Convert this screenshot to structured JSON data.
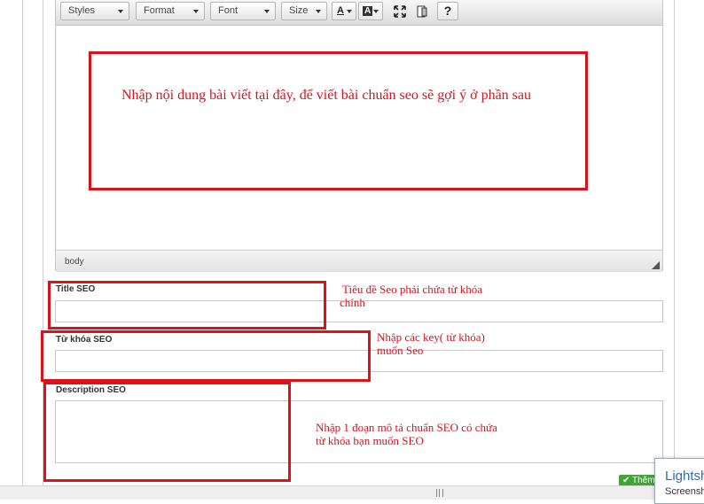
{
  "toolbar": {
    "styles_label": "Styles",
    "format_label": "Format",
    "font_label": "Font",
    "size_label": "Size",
    "text_color_glyph": "A",
    "bg_color_glyph": "A",
    "help_glyph": "?"
  },
  "editor": {
    "placeholder_text": "Nhập nội dung bài viết tại đây, để viết bài chuẩn seo sẽ gợi ý ở phần sau",
    "status_path": "body"
  },
  "fields": {
    "title_label": "Title SEO",
    "keyword_label": "Từ khóa SEO",
    "description_label": "Description SEO"
  },
  "notes": {
    "title_note": "Tiêu đề Seo phải chứa từ khóa chính",
    "keyword_note": "Nhập các key( từ khóa) muốn Seo",
    "description_note": "Nhập 1 đoạn mô tả chuẩn SEO có chứa từ khóa bạn muốn SEO"
  },
  "actions": {
    "add_button_label": "Thêm"
  },
  "popup": {
    "title": "Lightsh",
    "subtitle": "Screensh"
  },
  "colors": {
    "annotation_red": "#e0101a",
    "add_button_green": "#3fa535"
  }
}
